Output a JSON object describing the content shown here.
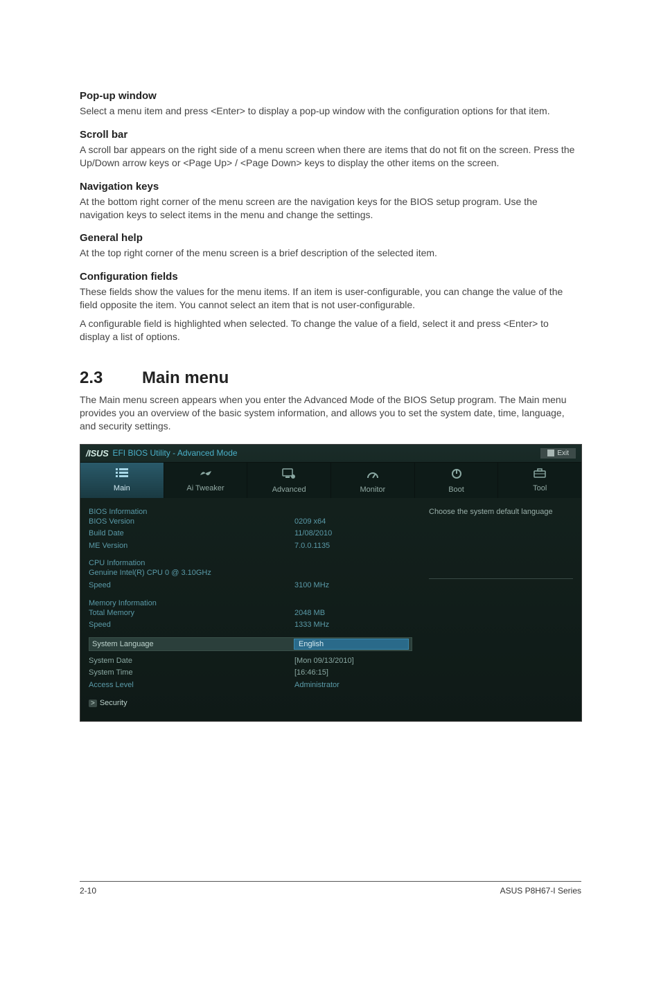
{
  "sections": {
    "popup": {
      "head": "Pop-up window",
      "text": "Select a menu item and press <Enter> to display a pop-up window with the configuration options for that item."
    },
    "scroll": {
      "head": "Scroll bar",
      "text": "A scroll bar appears on the right side of a menu screen when there are items that do not fit on the screen. Press the Up/Down arrow keys or <Page Up> / <Page Down> keys to display the other items on the screen."
    },
    "nav": {
      "head": "Navigation keys",
      "text": "At the bottom right corner of the menu screen are the navigation keys for the BIOS setup program. Use the navigation keys to select items in the menu and change the settings."
    },
    "help": {
      "head": "General help",
      "text": "At the top right corner of the menu screen is a brief description of the selected item."
    },
    "config": {
      "head": "Configuration fields",
      "text1": "These fields show the values for the menu items. If an item is user-configurable, you can change the value of the field opposite the item. You cannot select an item that is not user-configurable.",
      "text2": "A configurable field is highlighted when selected. To change the value of a field, select it and press <Enter> to display a list of options."
    }
  },
  "mainmenu": {
    "num": "2.3",
    "title": "Main menu",
    "intro": "The Main menu screen appears when you enter the Advanced Mode of the BIOS Setup program. The Main menu provides you an overview of the basic system information, and allows you to set the system date, time, language, and security settings."
  },
  "bios": {
    "logo": "/ISUS",
    "title": "EFI BIOS Utility - Advanced Mode",
    "exit": "Exit",
    "tabs": {
      "main": "Main",
      "tweaker": "Ai  Tweaker",
      "advanced": "Advanced",
      "monitor": "Monitor",
      "boot": "Boot",
      "tool": "Tool"
    },
    "help": "Choose the system default language",
    "groups": {
      "bios_info": "BIOS Information",
      "bios_version": {
        "label": "BIOS Version",
        "value": "0209 x64"
      },
      "build_date": {
        "label": "Build Date",
        "value": "11/08/2010"
      },
      "me_version": {
        "label": "ME Version",
        "value": "7.0.0.1135"
      },
      "cpu_info": "CPU Information",
      "cpu_model": "Genuine Intel(R) CPU 0 @ 3.10GHz",
      "cpu_speed": {
        "label": "Speed",
        "value": "3100 MHz"
      },
      "mem_info": "Memory Information",
      "total_mem": {
        "label": "Total Memory",
        "value": "2048 MB"
      },
      "mem_speed": {
        "label": "Speed",
        "value": "1333 MHz"
      },
      "sys_lang": {
        "label": "System Language",
        "value": "English"
      },
      "sys_date": {
        "label": "System Date",
        "value": "[Mon 09/13/2010]"
      },
      "sys_time": {
        "label": "System Time",
        "value": "[16:46:15]"
      },
      "access": {
        "label": "Access Level",
        "value": "Administrator"
      },
      "security": "Security"
    }
  },
  "footer": {
    "page": "2-10",
    "product": "ASUS P8H67-I Series"
  }
}
